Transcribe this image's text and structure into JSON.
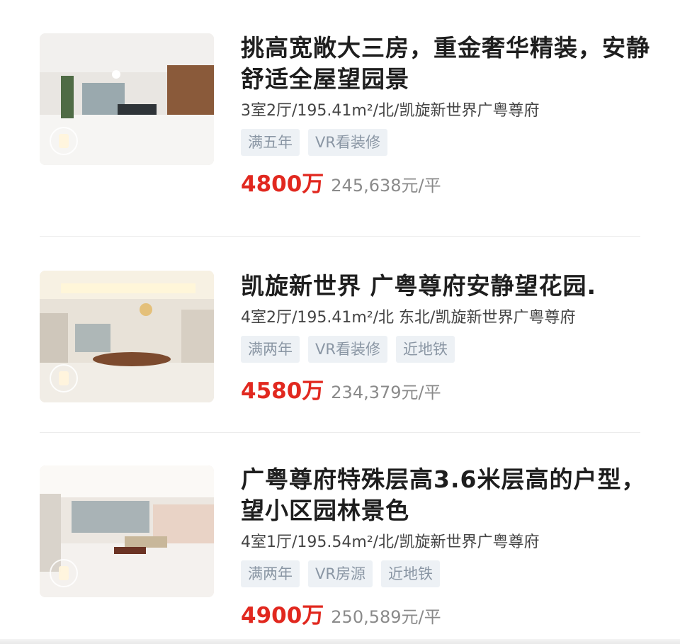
{
  "listings": [
    {
      "title": "挑高宽敞大三房，重金奢华精装，安静舒适全屋望园景",
      "meta": "3室2厅/195.41m²/北/凯旋新世界广粤尊府",
      "tags": [
        "满五年",
        "VR看装修"
      ],
      "price": "4800万",
      "unit_price": "245,638元/平"
    },
    {
      "title": "凯旋新世界 广粤尊府安静望花园.",
      "meta": "4室2厅/195.41m²/北 东北/凯旋新世界广粤尊府",
      "tags": [
        "满两年",
        "VR看装修",
        "近地铁"
      ],
      "price": "4580万",
      "unit_price": "234,379元/平"
    },
    {
      "title": "广粤尊府特殊层高3.6米层高的户型，望小区园林景色",
      "meta": "4室1厅/195.54m²/北/凯旋新世界广粤尊府",
      "tags": [
        "满两年",
        "VR房源",
        "近地铁"
      ],
      "price": "4900万",
      "unit_price": "250,589元/平"
    }
  ],
  "colors": {
    "price": "#e1281f",
    "tag_bg": "#edf1f5",
    "tag_text": "#8a96a4"
  }
}
